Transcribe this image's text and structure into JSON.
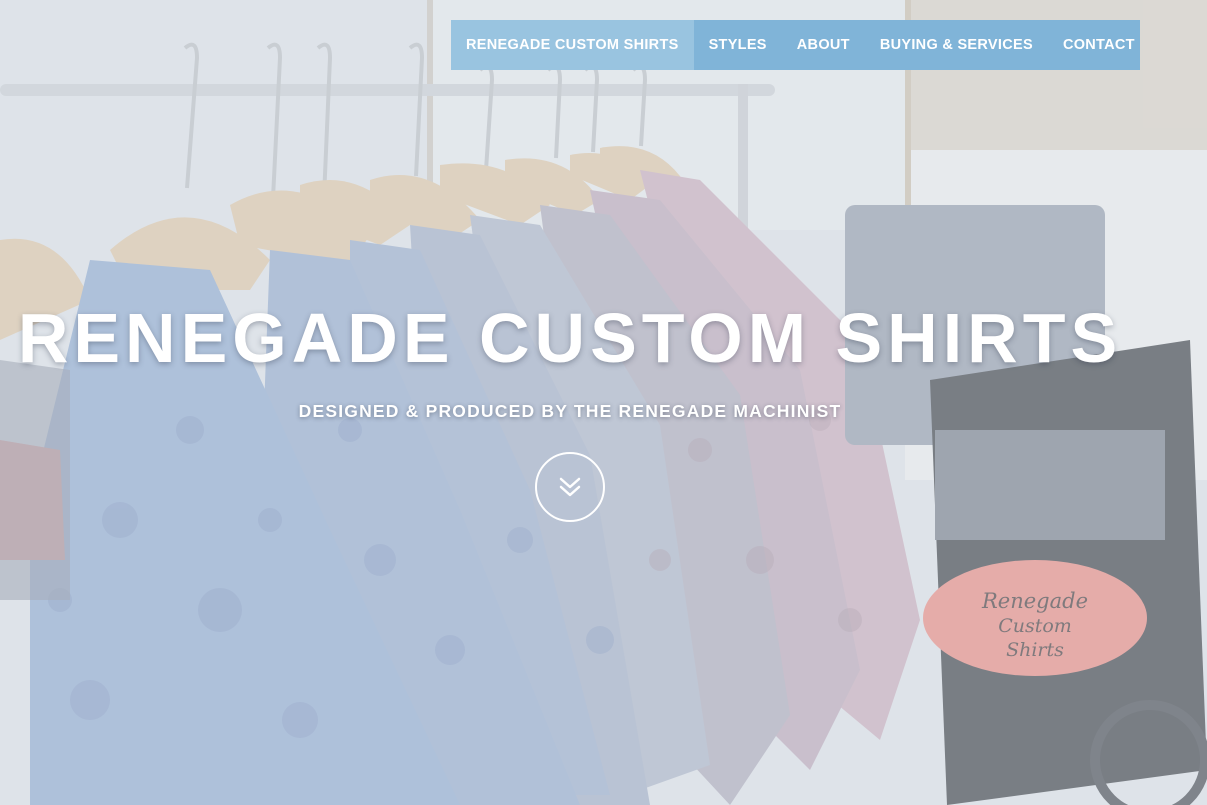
{
  "nav": {
    "items": [
      {
        "label": "RENEGADE CUSTOM SHIRTS",
        "active": true
      },
      {
        "label": "STYLES",
        "active": false
      },
      {
        "label": "ABOUT",
        "active": false
      },
      {
        "label": "BUYING & SERVICES",
        "active": false
      },
      {
        "label": "CONTACT",
        "active": false
      }
    ]
  },
  "hero": {
    "title": "RENEGADE CUSTOM SHIRTS",
    "subtitle": "DESIGNED & PRODUCED BY THE RENEGADE MACHINIST",
    "scroll_icon": "double-chevron-down-icon",
    "background_image": "shirts-on-rack-photo",
    "cart_sign_text": "Renegade Custom Shirts"
  },
  "colors": {
    "nav_background": "#80b4d8",
    "nav_active": "#99c4e0",
    "text": "#ffffff"
  }
}
